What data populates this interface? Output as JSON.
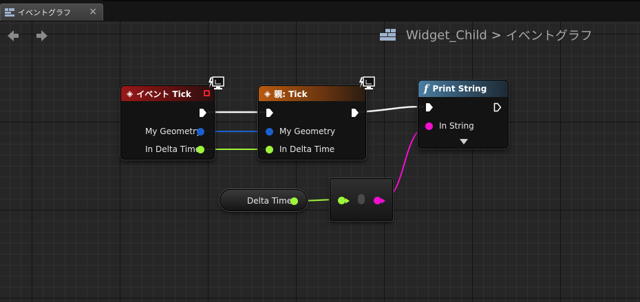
{
  "tab": {
    "title": "イベントグラフ",
    "close": "×",
    "icon": "blueprint-graph-icon"
  },
  "breadcrumb": {
    "blueprint": "Widget_Child",
    "separator": ">",
    "graph": "イベントグラフ",
    "icon": "blueprint-icon"
  },
  "nodes": {
    "event_tick": {
      "title": "イベント Tick",
      "pins": {
        "geometry": "My Geometry",
        "delta": "In Delta Time"
      }
    },
    "parent_tick": {
      "title": "親: Tick",
      "pins": {
        "geometry": "My Geometry",
        "delta": "In Delta Time"
      }
    },
    "print_string": {
      "title": "Print String",
      "pins": {
        "in_string": "In String"
      }
    },
    "delta_time_var": {
      "label": "Delta Time"
    }
  },
  "colors": {
    "event_header": "#9a1818",
    "parent_header": "#b85a10",
    "function_header": "#4a7da0",
    "struct_pin": "#1a60d0",
    "float_pin": "#9ef53a",
    "string_pin": "#f20fd0",
    "exec_wire": "#ffffff"
  }
}
